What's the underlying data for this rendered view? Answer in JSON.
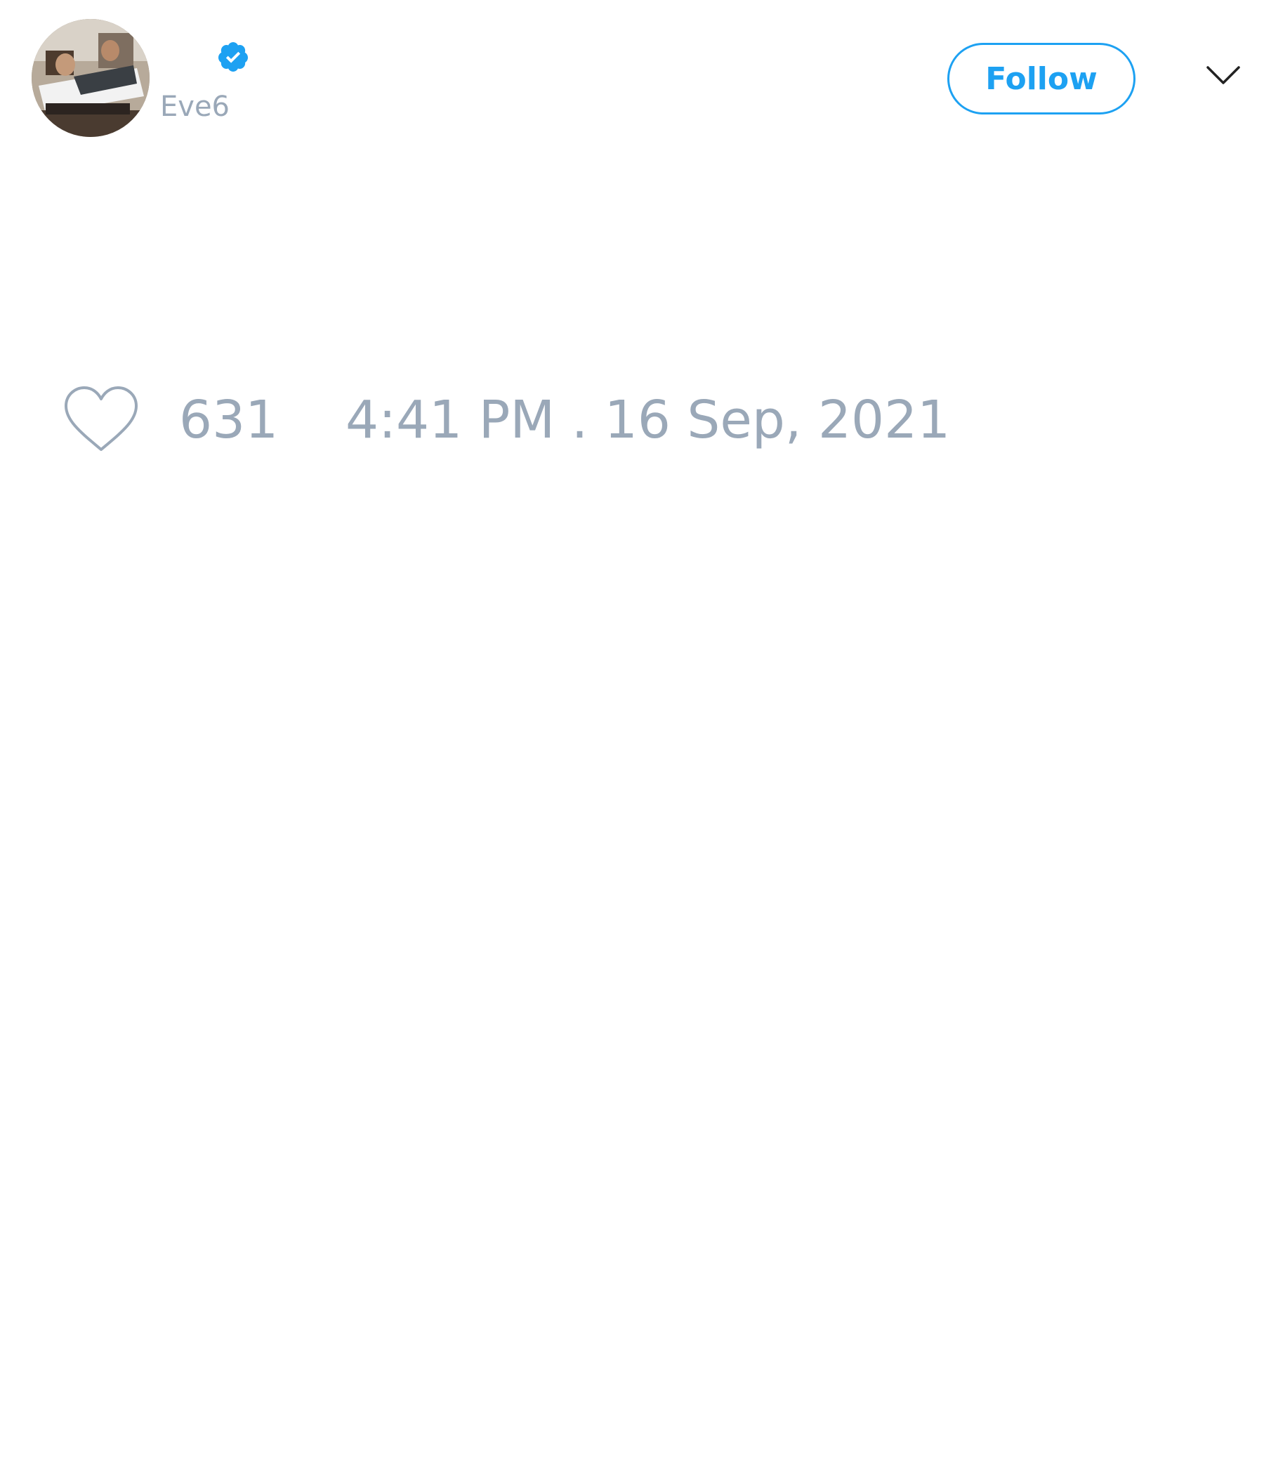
{
  "tweet": {
    "author": {
      "handle": "Eve6",
      "verified": true,
      "avatar_icon": "profile-photo"
    },
    "follow_label": "Follow",
    "menu_icon": "chevron-down-icon",
    "likes": {
      "icon": "heart-outline-icon",
      "count": "631"
    },
    "timestamp": "4:41 PM . 16 Sep, 2021"
  },
  "colors": {
    "accent": "#1da1f2",
    "muted_text": "#9aa8b8",
    "background": "#ffffff"
  }
}
